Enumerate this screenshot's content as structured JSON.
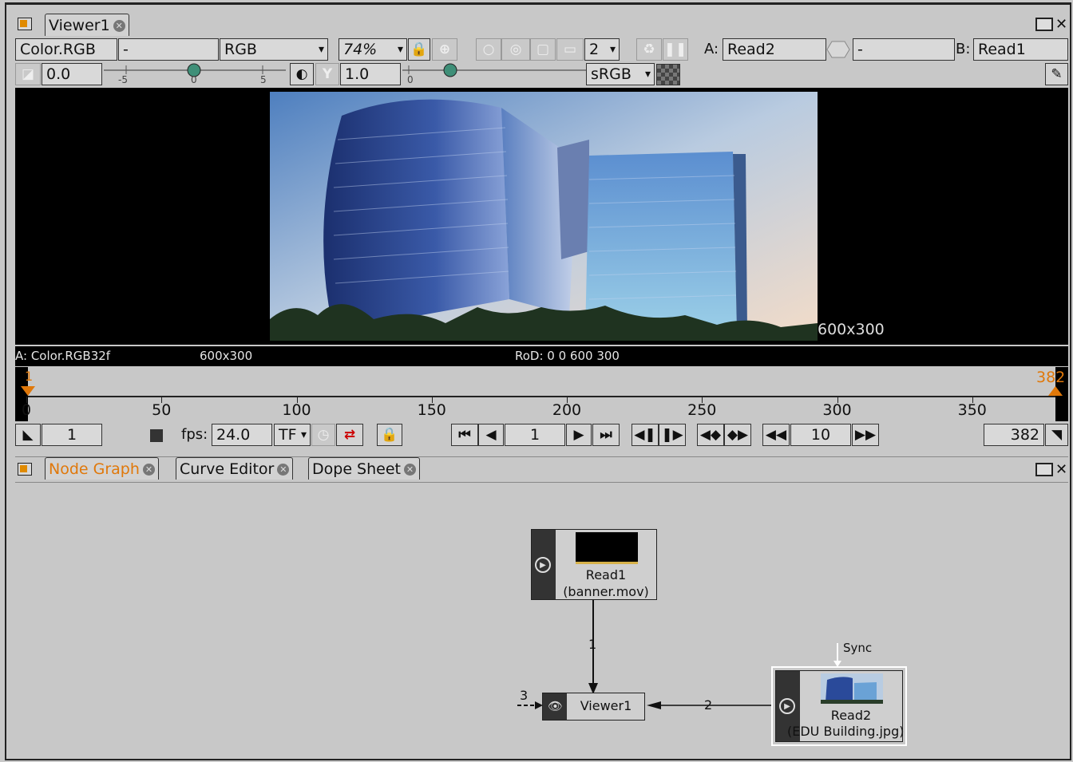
{
  "viewer": {
    "tab_label": "Viewer1",
    "layer": "Color.RGB",
    "layer_alpha": "-",
    "channels": "RGB",
    "zoom": "74%",
    "proxy_value": "2",
    "input_a_label": "A:",
    "input_a": "Read2",
    "operator": "-",
    "input_b_label": "B:",
    "input_b": "Read1",
    "gain": "0.0",
    "gamma": "1.0",
    "gain_ticks": [
      "-5",
      "0",
      "5"
    ],
    "gamma_tick": "0",
    "colorspace": "sRGB",
    "image_format_overlay": "600x300"
  },
  "info_bar": {
    "channel_info": "A: Color.RGB32f",
    "resolution": "600x300",
    "rod": "RoD: 0 0 600 300"
  },
  "timeline": {
    "start_marker": "1",
    "end_marker": "382",
    "tick_labels": [
      "0",
      "50",
      "100",
      "150",
      "200",
      "250",
      "300",
      "350"
    ],
    "first_frame": "1",
    "fps_label": "fps:",
    "fps": "24.0",
    "playback_mode": "TF",
    "current_frame": "1",
    "increment": "10",
    "last_frame": "382"
  },
  "bottom_panel": {
    "tabs": [
      {
        "label": "Node Graph",
        "active": true
      },
      {
        "label": "Curve Editor",
        "active": false
      },
      {
        "label": "Dope Sheet",
        "active": false
      }
    ]
  },
  "node_graph": {
    "read1": {
      "name": "Read1",
      "file": "(banner.mov)"
    },
    "read2": {
      "name": "Read2",
      "file": "(EDU Building.jpg)"
    },
    "viewer": {
      "name": "Viewer1"
    },
    "edge_labels": {
      "input1": "1",
      "input2": "2",
      "input3": "3"
    },
    "sync_label": "Sync"
  },
  "colors": {
    "accent_orange": "#e0780a",
    "panel_bg": "#c8c8c8",
    "viewer_bg": "#000000"
  }
}
